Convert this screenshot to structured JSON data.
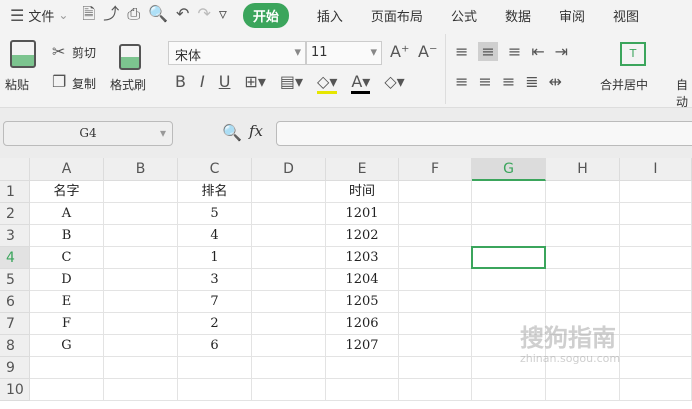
{
  "menu": {
    "file": "文件",
    "tabs": [
      "开始",
      "插入",
      "页面布局",
      "公式",
      "数据",
      "审阅",
      "视图"
    ]
  },
  "ribbon": {
    "paste": "粘贴",
    "cut": "剪切",
    "copy": "复制",
    "format_painter": "格式刷",
    "font_name": "宋体",
    "font_size": "11",
    "merge_center": "合并居中",
    "auto_wrap": "自动"
  },
  "formula": {
    "name_box": "G4",
    "fx": "fx",
    "value": ""
  },
  "columns": [
    "A",
    "B",
    "C",
    "D",
    "E",
    "F",
    "G",
    "H",
    "I"
  ],
  "rows": [
    "1",
    "2",
    "3",
    "4",
    "5",
    "6",
    "7",
    "8",
    "9",
    "10"
  ],
  "table": [
    [
      "名字",
      "排名",
      "时间"
    ],
    [
      "A",
      "5",
      "1201"
    ],
    [
      "B",
      "4",
      "1202"
    ],
    [
      "C",
      "1",
      "1203"
    ],
    [
      "D",
      "3",
      "1204"
    ],
    [
      "E",
      "7",
      "1205"
    ],
    [
      "F",
      "2",
      "1206"
    ],
    [
      "G",
      "6",
      "1207"
    ]
  ],
  "selected_cell": "G4",
  "watermark": {
    "title": "搜狗指南",
    "url": "zhinan.sogou.com"
  },
  "colors": {
    "accent": "#3ba55c"
  }
}
